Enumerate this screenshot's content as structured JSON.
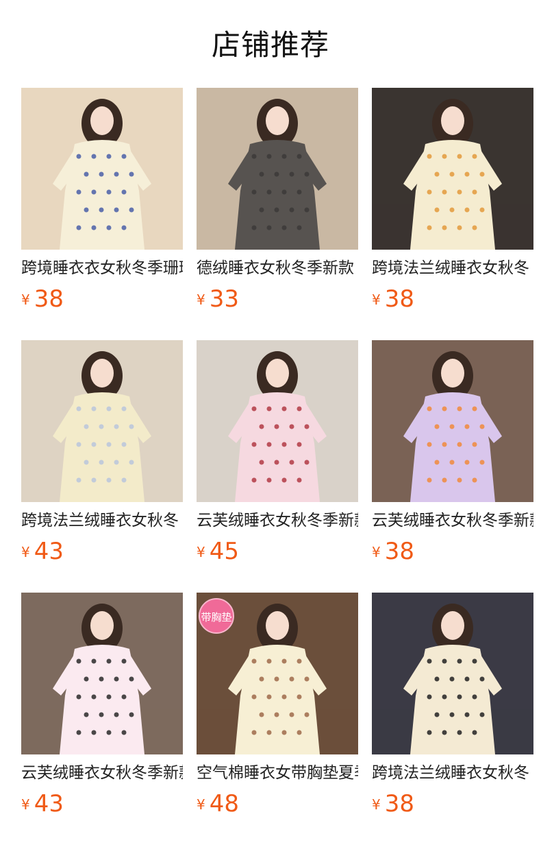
{
  "page": {
    "title": "店铺推荐"
  },
  "colors": {
    "price": "#f05a16",
    "title": "#111111",
    "name": "#222222"
  },
  "products": [
    {
      "name": "跨境睡衣衣女秋冬季珊瑚绒",
      "currency": "¥",
      "price": "38",
      "photo": "cream pajama dress with cartoon puppies, seated pose",
      "bg": "#e8d7bf",
      "garment": "#f6efd8",
      "accent": "#4a5fa8"
    },
    {
      "name": "德绒睡衣女秋冬季新款",
      "currency": "¥",
      "price": "33",
      "photo": "dark grey collared pajama set, seated",
      "bg": "#c9b8a3",
      "garment": "#575350",
      "accent": "#3c3a38"
    },
    {
      "name": "跨境法兰绒睡衣女秋冬",
      "currency": "¥",
      "price": "38",
      "photo": "cream polka-dot ruffle pajamas on bed",
      "bg": "#3a3430",
      "garment": "#f5ecd0",
      "accent": "#e39a3c"
    },
    {
      "name": "跨境法兰绒睡衣女秋冬",
      "currency": "¥",
      "price": "43",
      "photo": "cream striped lace pajamas seated on floor",
      "bg": "#ded3c3",
      "garment": "#f3ebca",
      "accent": "#b9c6dc"
    },
    {
      "name": "云芙绒睡衣女秋冬季新款",
      "currency": "¥",
      "price": "45",
      "photo": "pink pajama dress with bear prints on sofa",
      "bg": "#d9d2c9",
      "garment": "#f6d9e0",
      "accent": "#b23a44"
    },
    {
      "name": "云芙绒睡衣女秋冬季新款",
      "currency": "¥",
      "price": "38",
      "photo": "colorful heart-print pajama dress on chair",
      "bg": "#7a6255",
      "garment": "#d9c6ec",
      "accent": "#f0893c"
    },
    {
      "name": "云芙绒睡衣女秋冬季新款",
      "currency": "¥",
      "price": "43",
      "photo": "pink striped flower-print pajama set",
      "bg": "#7d6a5e",
      "garment": "#fbeaf0",
      "accent": "#2a2a2a"
    },
    {
      "name": "空气棉睡衣女带胸垫夏季",
      "currency": "¥",
      "price": "48",
      "photo": "cream print pajama dress holding plush toy",
      "bg": "#6b4f3b",
      "garment": "#f7efd4",
      "accent": "#9f6a4a",
      "tag": "带胸垫"
    },
    {
      "name": "跨境法兰绒睡衣女秋冬",
      "currency": "¥",
      "price": "38",
      "photo": "cream black-print ruffle pajamas by window",
      "bg": "#3b3a45",
      "garment": "#f4ead3",
      "accent": "#222222"
    }
  ]
}
